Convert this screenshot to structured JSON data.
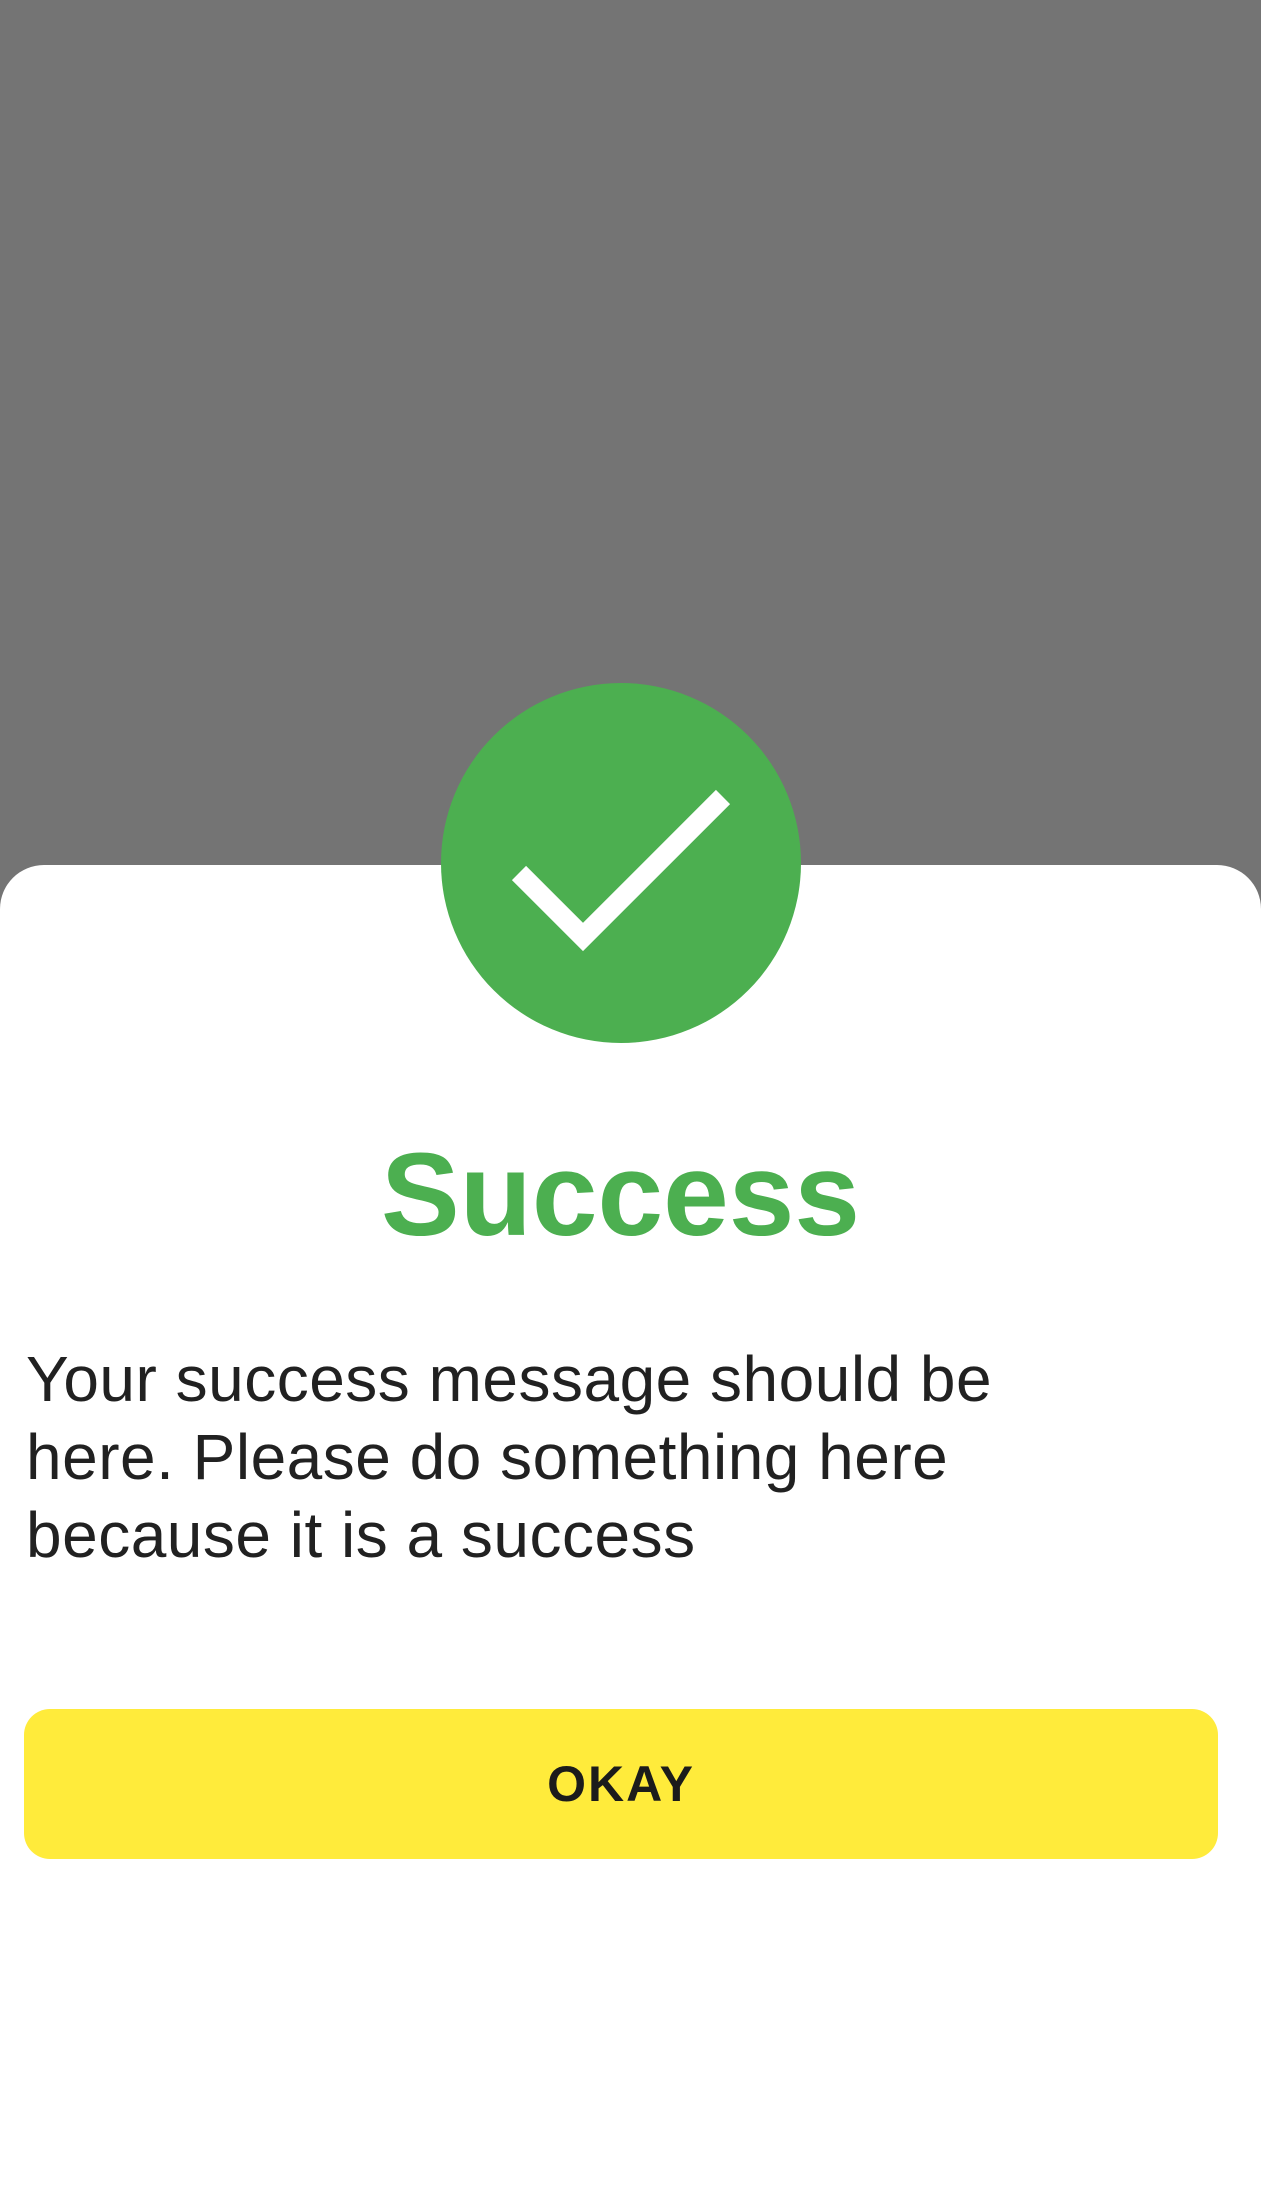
{
  "dialog": {
    "icon": "checkmark-icon",
    "title": "Success",
    "message": "Your success message should be here. Please do something here because it is a success",
    "button_label": "OKAY"
  },
  "colors": {
    "backdrop": "#747474",
    "sheet": "#ffffff",
    "success_green": "#4caf50",
    "button_yellow": "#ffeb3b",
    "text_dark": "#212121"
  }
}
